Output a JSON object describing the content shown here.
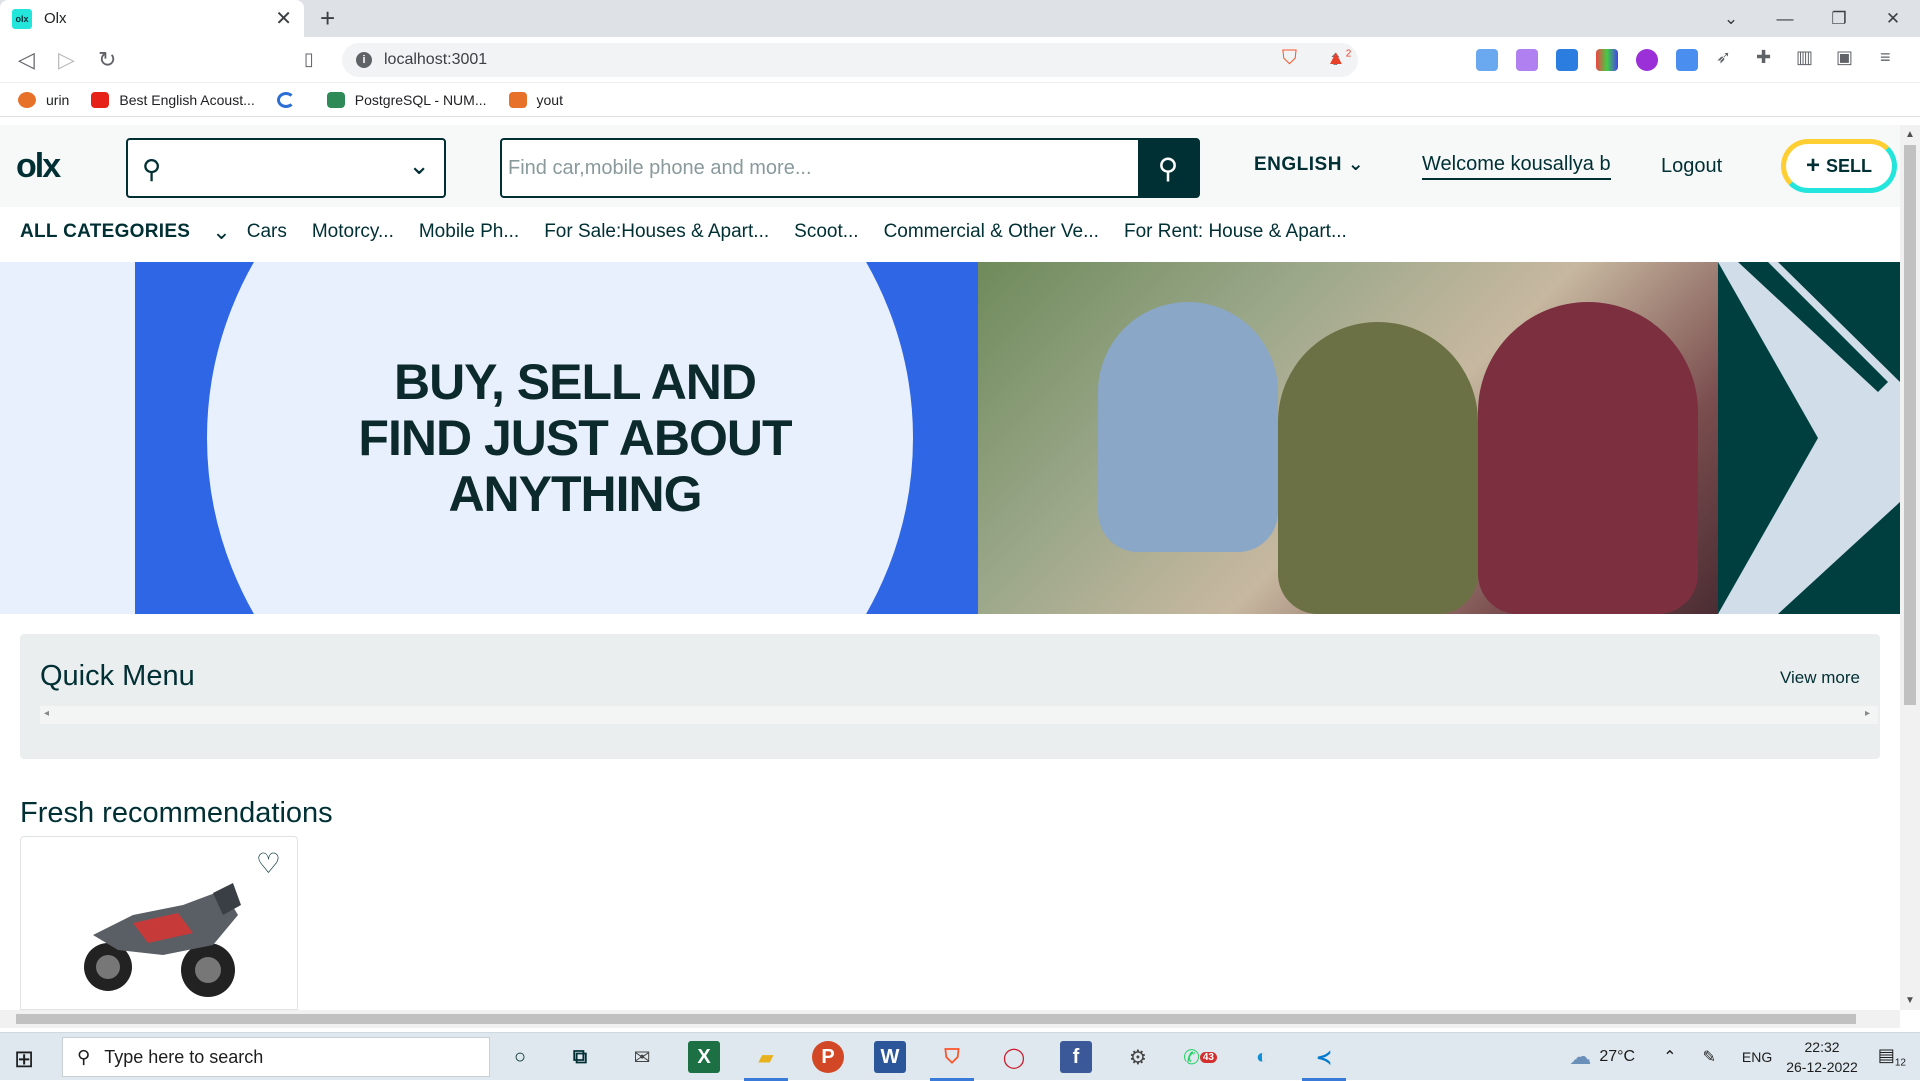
{
  "browser": {
    "tab_title": "Olx",
    "tab_favicon": "olx",
    "url": "localhost:3001",
    "brave_badge": "2",
    "bookmarks": [
      {
        "label": "urin",
        "color": "#e8712a"
      },
      {
        "label": "Best English Acoust...",
        "color": "#e62117"
      },
      {
        "label": "",
        "color": "#2b6fd6"
      },
      {
        "label": "PostgreSQL - NUM...",
        "color": "#2e8b57"
      },
      {
        "label": "yout",
        "color": "#e8712a"
      }
    ]
  },
  "olx": {
    "logo": "olx",
    "search_placeholder": "Find car,mobile phone and more...",
    "language": "ENGLISH",
    "welcome": "Welcome kousallya b",
    "logout": "Logout",
    "sell": "SELL",
    "all_categories": "ALL CATEGORIES",
    "categories": [
      "Cars",
      "Motorcy...",
      "Mobile Ph...",
      "For Sale:Houses & Apart...",
      "Scoot...",
      "Commercial & Other Ve...",
      "For Rent: House & Apart..."
    ],
    "banner_line1": "BUY, SELL AND",
    "banner_line2": "FIND JUST ABOUT",
    "banner_line3": "ANYTHING",
    "quick_menu_title": "Quick Menu",
    "view_more": "View more",
    "fresh_title": "Fresh recommendations",
    "colors": {
      "brand": "#002f34",
      "accent_teal": "#23e5db",
      "accent_yellow": "#ffce32",
      "accent_blue": "#3a77ff"
    }
  },
  "taskbar": {
    "search_placeholder": "Type here to search",
    "weather": "27°C",
    "lang": "ENG",
    "time": "22:32",
    "date": "26-12-2022",
    "whatsapp_badge": "43",
    "notif_count": "12"
  }
}
